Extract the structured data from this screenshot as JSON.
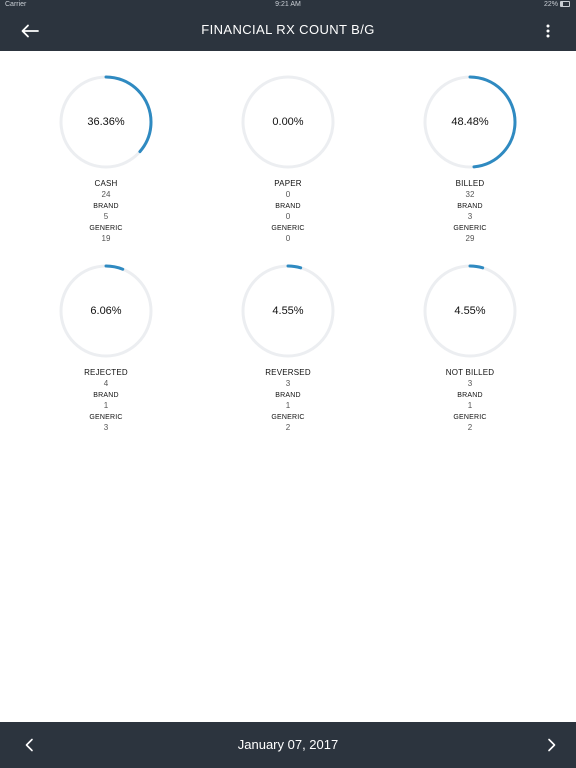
{
  "status_bar": {
    "carrier": "Carrier",
    "time": "9:21 AM",
    "battery": "22%"
  },
  "header": {
    "title": "FINANCIAL RX COUNT B/G",
    "back_icon": "arrow-left-icon",
    "menu_icon": "more-vertical-icon"
  },
  "colors": {
    "bar": "#2c343e",
    "accent": "#2f8ac1",
    "track": "#eceef1"
  },
  "cards": [
    {
      "percent_label": "36.36%",
      "percent": 36.36,
      "label": "CASH",
      "total": "24",
      "brand_label": "BRAND",
      "brand": "5",
      "generic_label": "GENERIC",
      "generic": "19"
    },
    {
      "percent_label": "0.00%",
      "percent": 0,
      "label": "PAPER",
      "total": "0",
      "brand_label": "BRAND",
      "brand": "0",
      "generic_label": "GENERIC",
      "generic": "0"
    },
    {
      "percent_label": "48.48%",
      "percent": 48.48,
      "label": "BILLED",
      "total": "32",
      "brand_label": "BRAND",
      "brand": "3",
      "generic_label": "GENERIC",
      "generic": "29"
    },
    {
      "percent_label": "6.06%",
      "percent": 6.06,
      "label": "REJECTED",
      "total": "4",
      "brand_label": "BRAND",
      "brand": "1",
      "generic_label": "GENERIC",
      "generic": "3"
    },
    {
      "percent_label": "4.55%",
      "percent": 4.55,
      "label": "REVERSED",
      "total": "3",
      "brand_label": "BRAND",
      "brand": "1",
      "generic_label": "GENERIC",
      "generic": "2"
    },
    {
      "percent_label": "4.55%",
      "percent": 4.55,
      "label": "NOT BILLED",
      "total": "3",
      "brand_label": "BRAND",
      "brand": "1",
      "generic_label": "GENERIC",
      "generic": "2"
    }
  ],
  "footer": {
    "date": "January 07, 2017",
    "prev_icon": "chevron-left-icon",
    "next_icon": "chevron-right-icon"
  }
}
